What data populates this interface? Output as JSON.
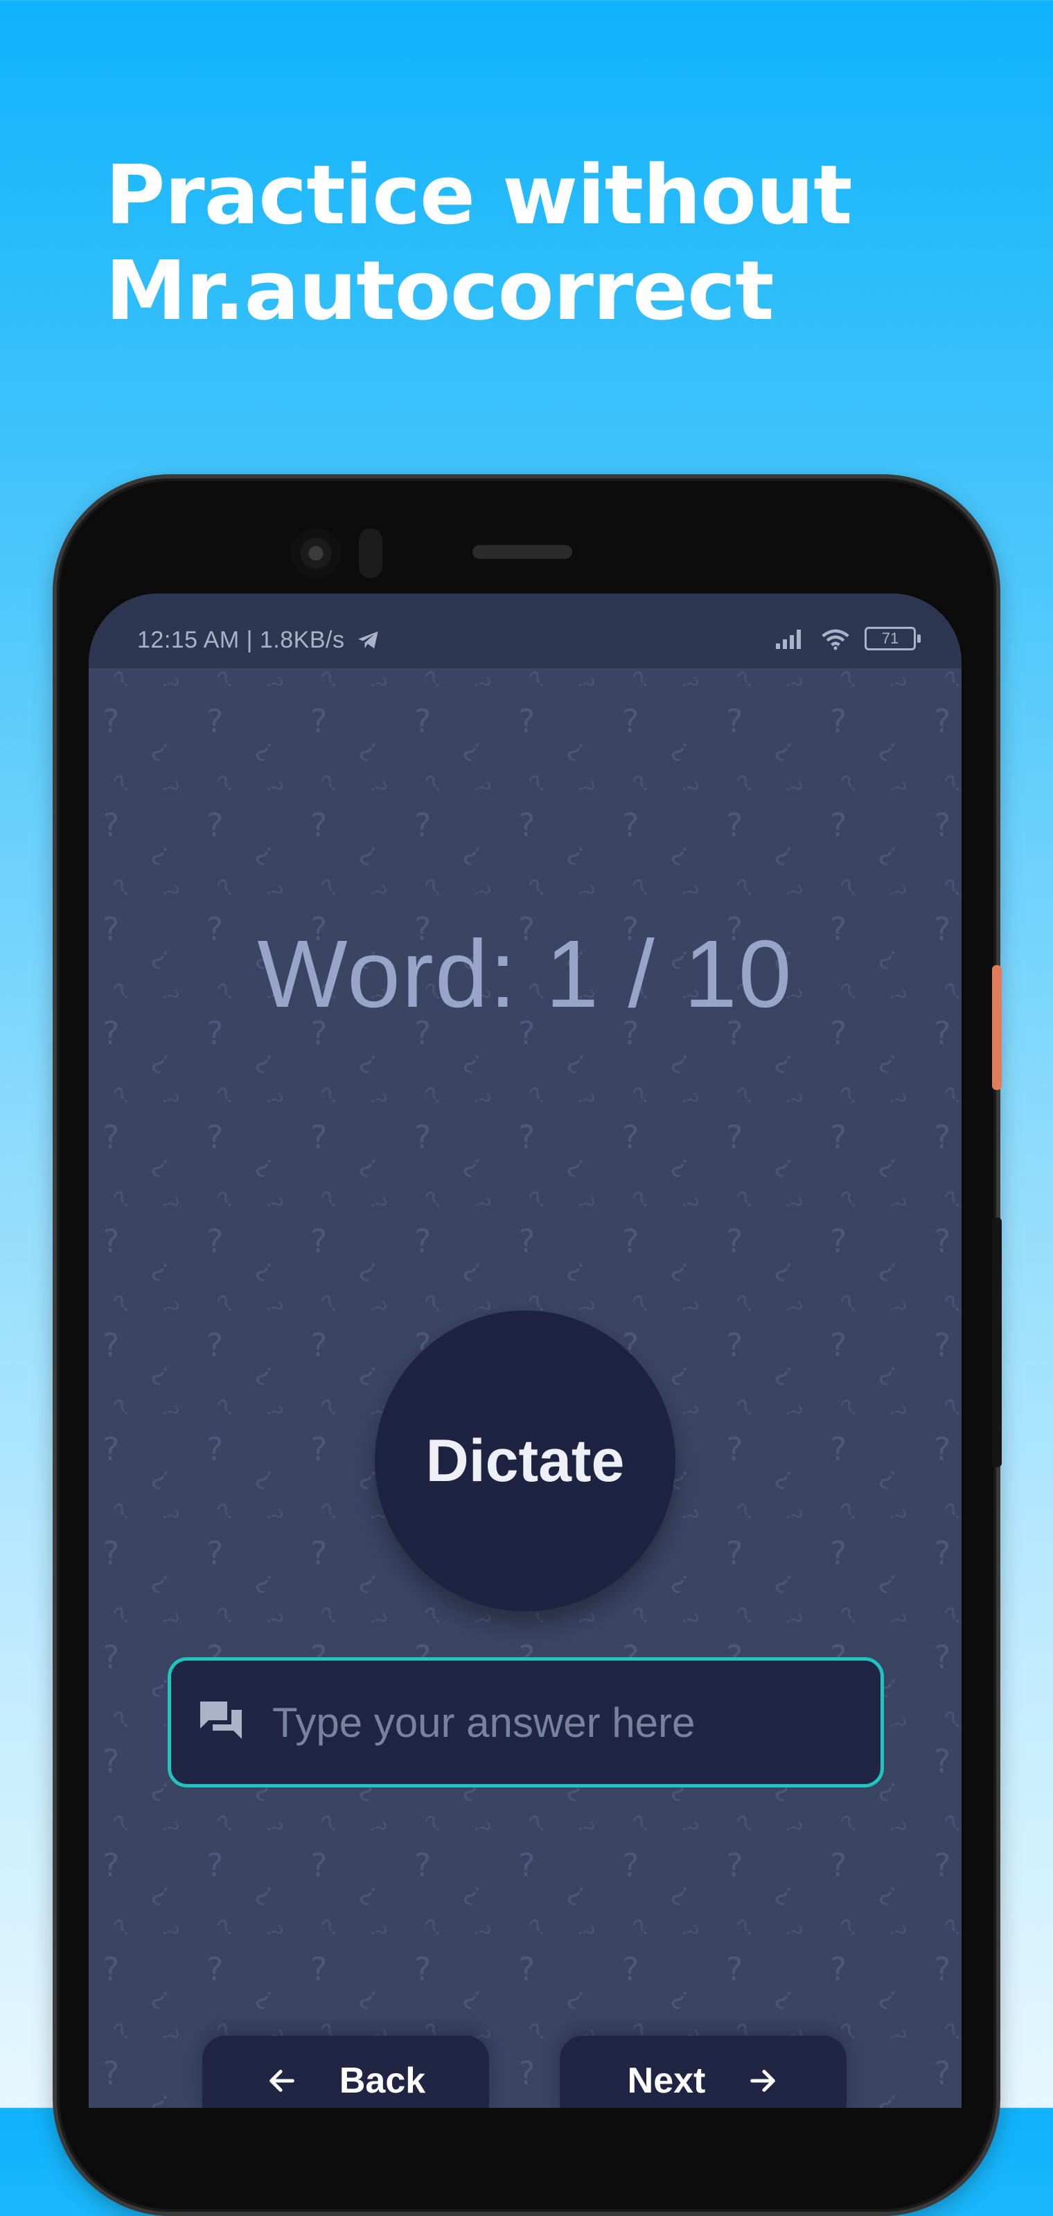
{
  "headline": {
    "line1": "Practice without",
    "line2": "Mr.autocorrect"
  },
  "statusbar": {
    "time": "12:15 AM | 1.8KB/s",
    "battery": "71"
  },
  "quiz": {
    "word_counter": "Word: 1 / 10",
    "dictate_label": "Dictate"
  },
  "answer": {
    "placeholder": "Type your answer here",
    "value": ""
  },
  "nav": {
    "back_label": "Back",
    "next_label": "Next"
  },
  "icons": {
    "chat": "chat-bubbles-icon",
    "back": "arrow-left-icon",
    "next": "arrow-right-icon",
    "send": "telegram-icon"
  },
  "colors": {
    "screen_bg": "#3a4463",
    "accent": "#20c3bf",
    "button_bg": "#1d2340"
  }
}
